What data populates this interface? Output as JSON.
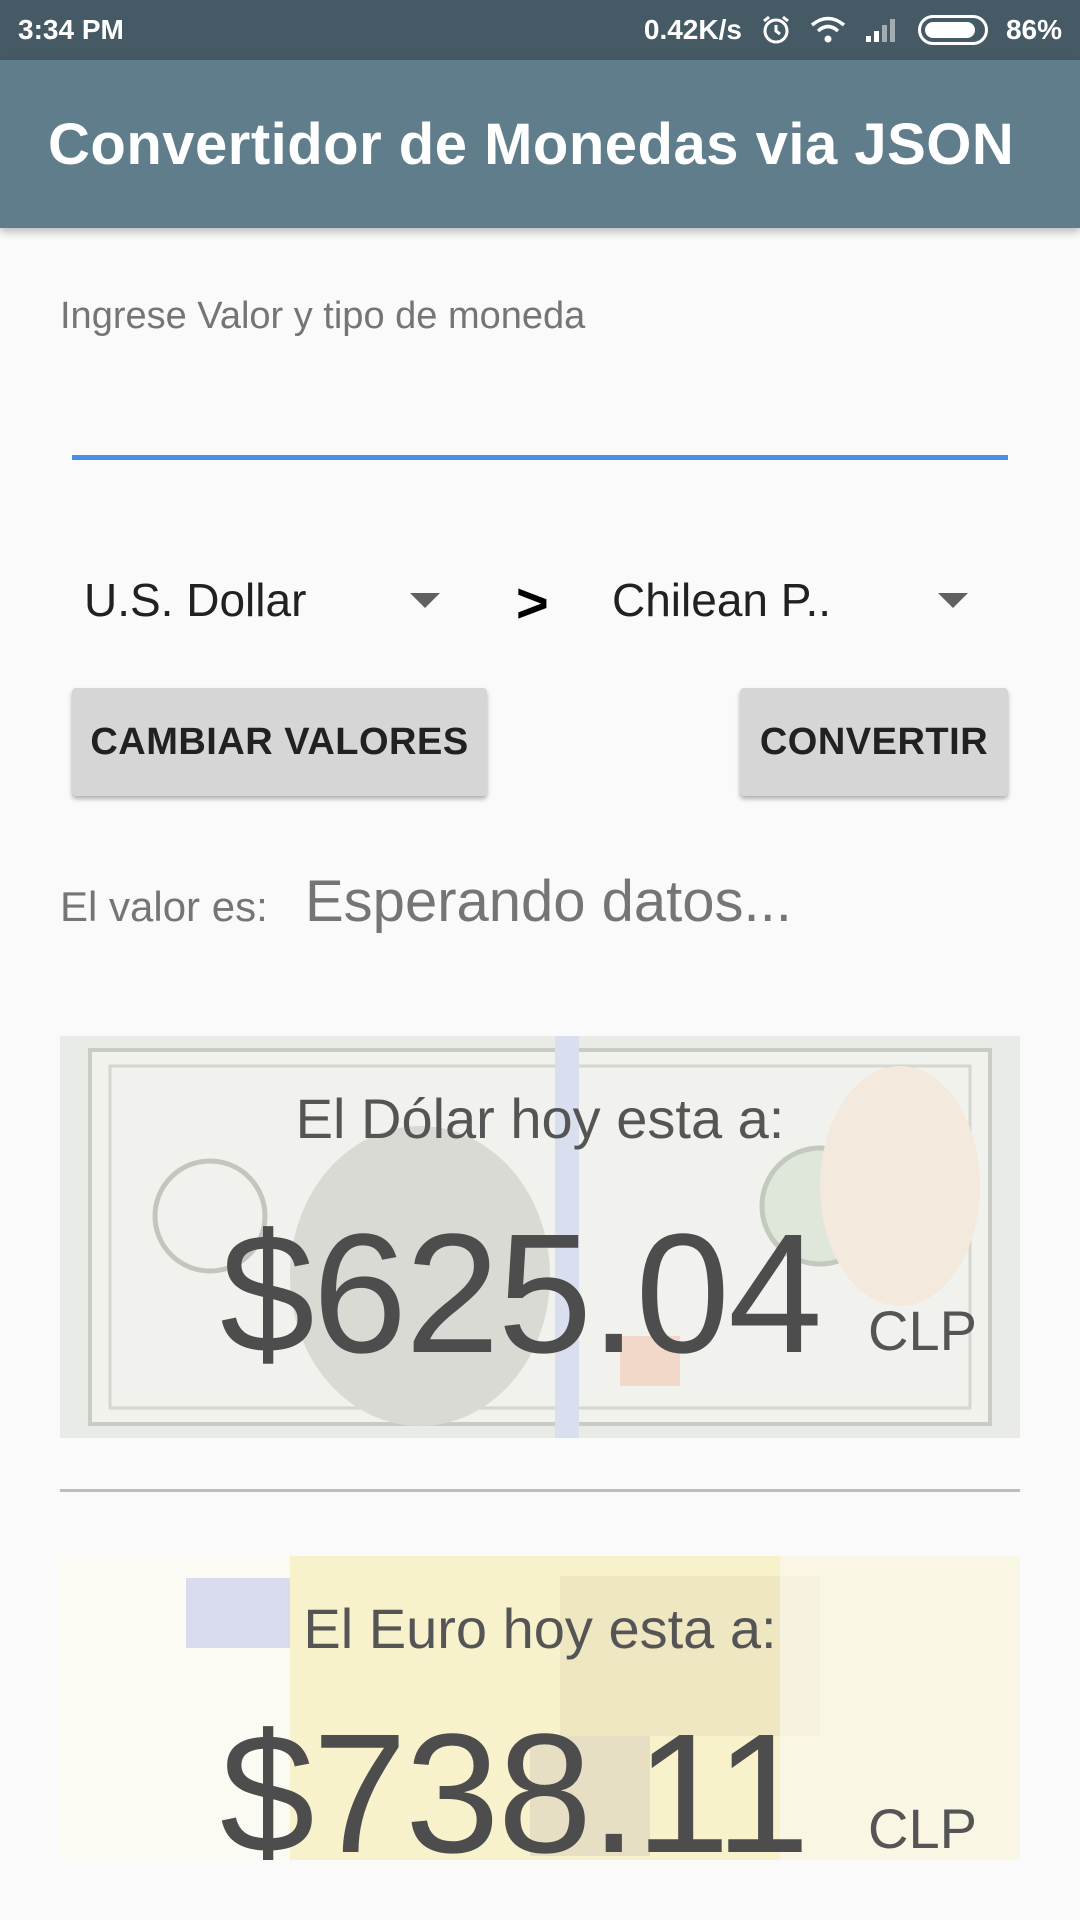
{
  "status_bar": {
    "time": "3:34 PM",
    "speed": "0.42K/s",
    "battery": "86%",
    "icons": [
      "alarm-icon",
      "wifi-icon",
      "signal-icon",
      "battery-icon"
    ]
  },
  "app_bar": {
    "title": "Convertidor de Monedas via JSON"
  },
  "input": {
    "label": "Ingrese Valor y tipo de moneda",
    "value": ""
  },
  "spinners": {
    "from": "U.S. Dollar",
    "arrow": ">",
    "to": "Chilean P.."
  },
  "buttons": {
    "swap": "CAMBIAR VALORES",
    "convert": "CONVERTIR"
  },
  "result": {
    "label": "El valor es:",
    "value": "Esperando datos..."
  },
  "dollar_card": {
    "title": "El Dólar hoy esta a:",
    "amount": "$625.04",
    "unit": "CLP"
  },
  "euro_card": {
    "title": "El Euro hoy esta a:",
    "amount": "$738.11",
    "unit": "CLP"
  },
  "colors": {
    "status_bar": "#455a64",
    "app_bar": "#607d8b",
    "input_underline": "#4a90e2",
    "button_bg": "#d6d6d6"
  }
}
